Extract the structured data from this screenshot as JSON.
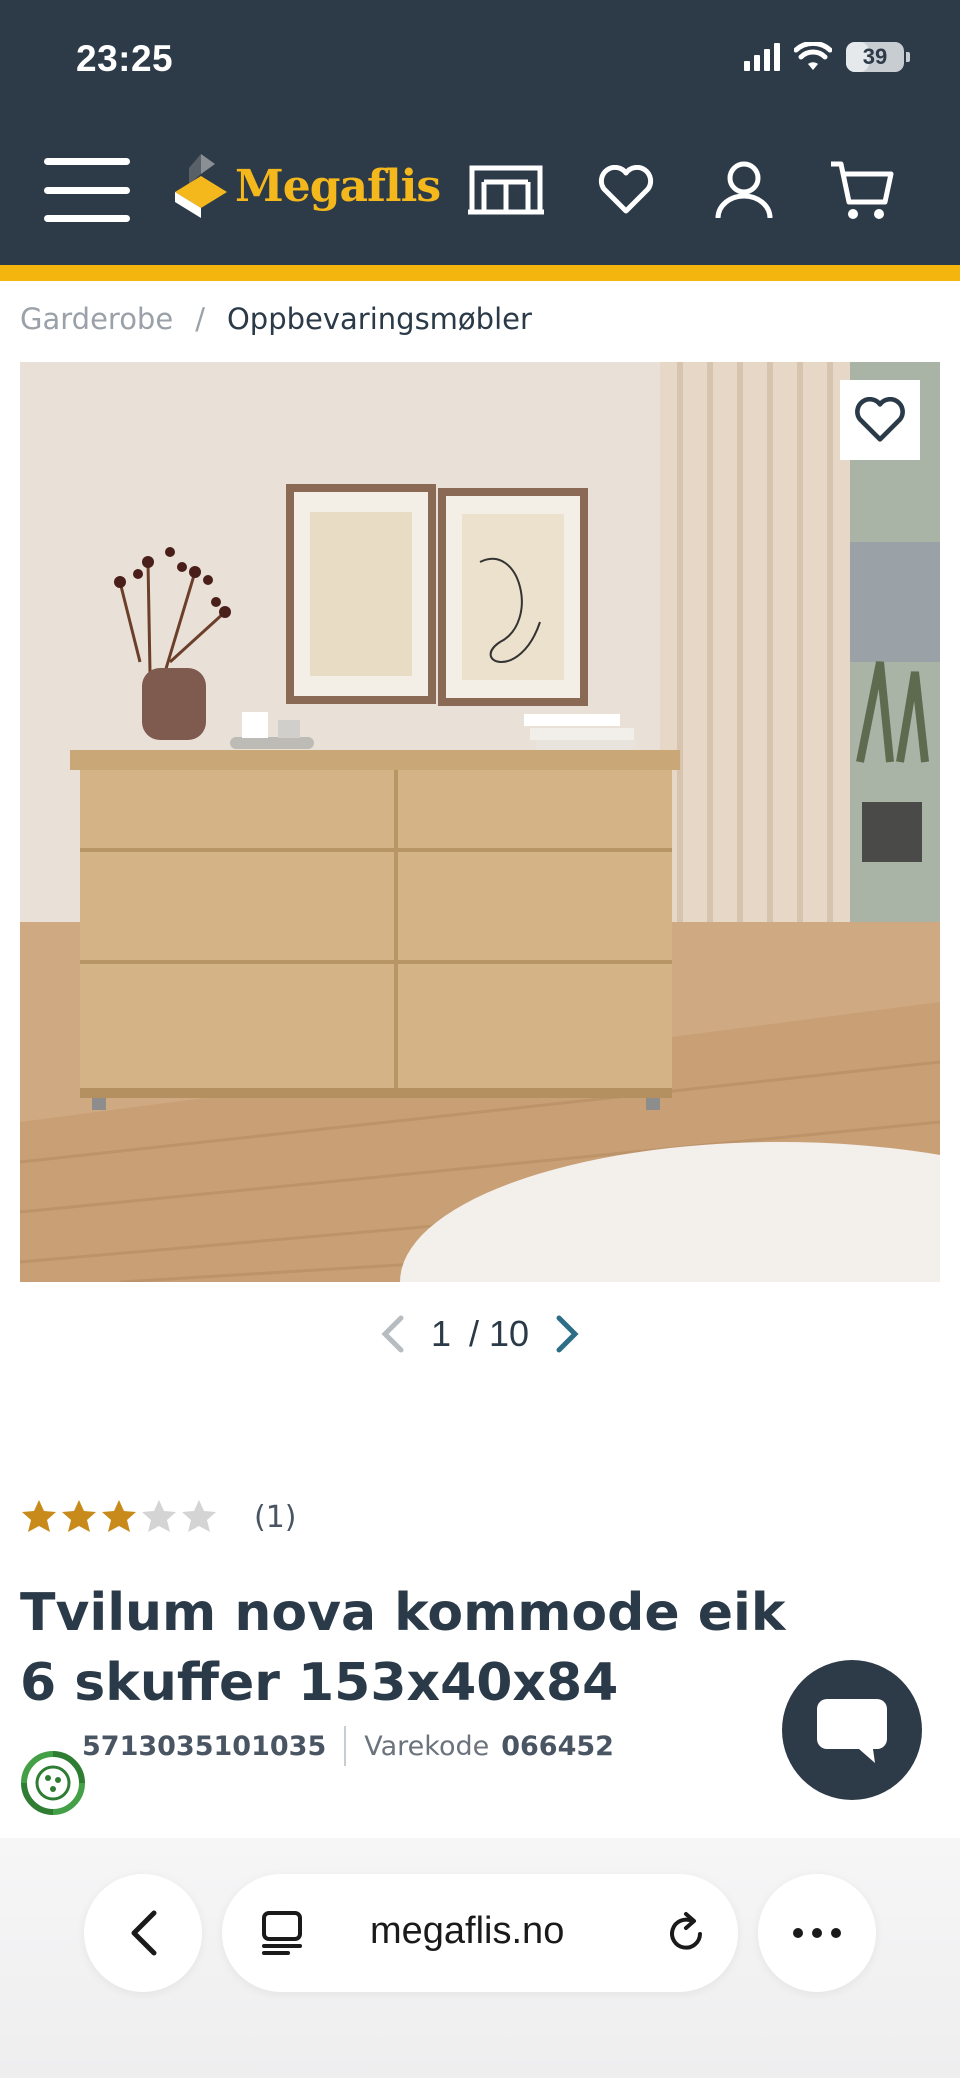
{
  "status_bar": {
    "time": "23:25",
    "battery": "39",
    "battery_level": 0.39,
    "icons": [
      "cellular-signal-icon",
      "wifi-icon",
      "battery-icon"
    ]
  },
  "header": {
    "logo_text": "Megaflis",
    "icons": [
      "menu-icon",
      "showroom-store-icon",
      "heart-icon",
      "user-icon",
      "cart-icon"
    ]
  },
  "breadcrumb": {
    "items": [
      "Garderobe",
      "Oppbevaringsmøbler"
    ],
    "separator": "/"
  },
  "gallery": {
    "current": "1",
    "separator": "/",
    "total": "10",
    "icons": [
      "chevron-left-icon",
      "chevron-right-icon",
      "heart-icon"
    ]
  },
  "product": {
    "rating": 3,
    "rating_max": 5,
    "rating_count": "(1)",
    "title": "Tvilum nova kommode eik 6 skuffer 153x40x84",
    "ean": "5713035101035",
    "item_code_label": "Varekode",
    "item_code": "066452"
  },
  "browser": {
    "url": "megaflis.no",
    "icons": [
      "back-chevron-icon",
      "tabs-icon",
      "reload-icon",
      "more-dots-icon"
    ]
  },
  "colors": {
    "header_bg": "#2d3a48",
    "accent_yellow": "#f5b50f",
    "star_filled": "#c88a1a",
    "star_empty": "#d4d4d4",
    "text_dark": "#2b3a48"
  }
}
